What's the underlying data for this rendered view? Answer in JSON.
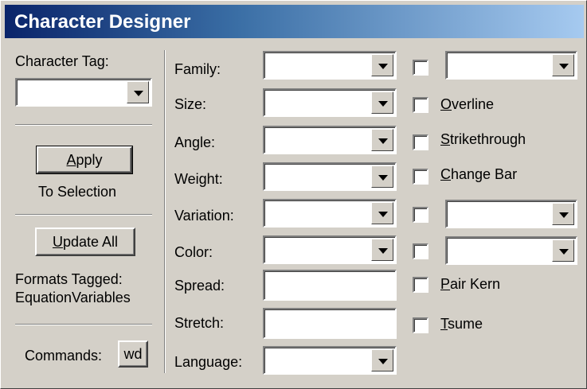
{
  "window": {
    "title": "Character Designer"
  },
  "left": {
    "character_tag_label": "Character Tag:",
    "character_tag_value": "",
    "apply_button": {
      "mnemonic": "A",
      "rest": "pply"
    },
    "to_selection": "To Selection",
    "update_all_button": {
      "mnemonic": "U",
      "rest": "pdate All"
    },
    "formats_tagged_label": "Formats Tagged:",
    "formats_tagged_value": "EquationVariables",
    "commands_label": "Commands:",
    "commands_button": "wd"
  },
  "fields": {
    "family": {
      "label": "Family:",
      "value": ""
    },
    "size": {
      "label": "Size:",
      "value": ""
    },
    "angle": {
      "label": "Angle:",
      "value": ""
    },
    "weight": {
      "label": "Weight:",
      "value": ""
    },
    "variation": {
      "label": "Variation:",
      "value": ""
    },
    "color": {
      "label": "Color:",
      "value": ""
    },
    "spread": {
      "label": "Spread:",
      "value": ""
    },
    "stretch": {
      "label": "Stretch:",
      "value": ""
    },
    "language": {
      "label": "Language:",
      "value": ""
    }
  },
  "options": {
    "overline": {
      "mnemonic": "O",
      "rest": "verline",
      "checked": false
    },
    "strikethrough": {
      "mnemonic": "S",
      "rest": "trikethrough",
      "checked": false
    },
    "change_bar": {
      "mnemonic": "C",
      "rest": "hange Bar",
      "checked": false
    },
    "pair_kern": {
      "mnemonic": "P",
      "rest": "air Kern",
      "checked": false
    },
    "tsume": {
      "mnemonic": "T",
      "rest": "sume",
      "checked": false
    },
    "underline_style_value": "",
    "superscript_value": "",
    "capitalization_value": ""
  }
}
